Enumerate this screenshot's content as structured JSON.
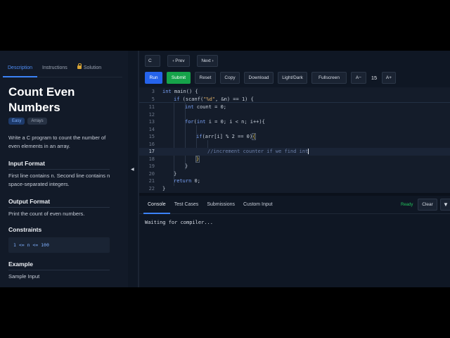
{
  "sidebar": {
    "tabs": [
      {
        "label": "Description"
      },
      {
        "label": "Instructions"
      },
      {
        "label": "Solution"
      }
    ],
    "title": "Count Even Numbers",
    "tags": [
      "Easy",
      "Arrays"
    ],
    "description": "Write a C program to count the number of even elements in an array.",
    "input_heading": "Input Format",
    "input_text": "First line contains n. Second line contains n space-separated integers.",
    "output_heading": "Output Format",
    "output_text": "Print the count of even numbers.",
    "constraints_heading": "Constraints",
    "constraints_code": "1 <= n <= 100",
    "example_heading": "Example",
    "sample_input_label": "Sample Input",
    "collapse_glyph": "◀"
  },
  "toolbar": {
    "language": "C",
    "prev": "‹ Prev",
    "next": "Next ›",
    "run": "Run",
    "submit": "Submit",
    "reset": "Reset",
    "copy": "Copy",
    "download": "Download",
    "theme": "Light/Dark",
    "fullscreen": "Fullscreen",
    "font_minus": "A−",
    "font_size": "15",
    "font_plus": "A+"
  },
  "editor": {
    "line_numbers": [
      "3",
      "5",
      "11",
      "12",
      "13",
      "14",
      "15",
      "16",
      "17",
      "18",
      "19",
      "20",
      "21",
      "22"
    ],
    "sticky_1_kw": "int",
    "sticky_1_rest": " main() {",
    "sticky_2_kw": "if",
    "sticky_2_a": " (scanf(",
    "sticky_2_str": "\"%d\"",
    "sticky_2_b": ", &n) == 1) {",
    "l11_kw": "int",
    "l11_rest": " count = 0;",
    "l13_kw": "for",
    "l13_a": "(",
    "l13_kw2": "int",
    "l13_b": " i = 0; i < n; i++){",
    "l15_kw": "if",
    "l15_a": "(arr[i] % 2 == 0)",
    "l15_brace": "{",
    "l17_comment": "//increment counter if we find int",
    "l18_brace": "}",
    "l19": "}",
    "l20": "}",
    "l21_kw": "return",
    "l21_rest": " 0;",
    "l22": "}"
  },
  "console": {
    "tabs": [
      "Console",
      "Test Cases",
      "Submissions",
      "Custom Input"
    ],
    "status": "Ready",
    "clear": "Clear",
    "menu_glyph": "▼",
    "output": "Waiting for compiler..."
  }
}
